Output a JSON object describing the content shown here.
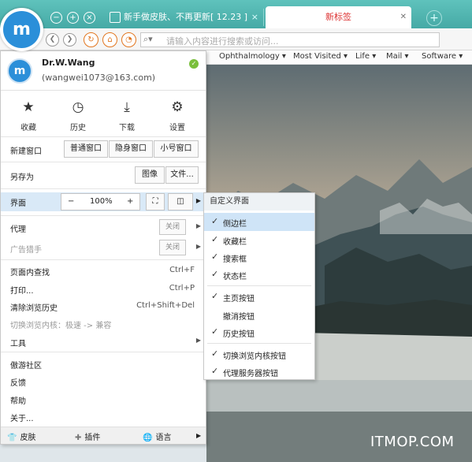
{
  "tabs": [
    {
      "label": "新手做皮肤、不再更新[ 12.23 ]",
      "active": false
    },
    {
      "label": "新标签",
      "active": true
    }
  ],
  "address_bar": {
    "placeholder": "请输入内容进行搜索或访问..."
  },
  "bookmarks": [
    "Ophthalmology",
    "Most Visited",
    "Life",
    "Mail",
    "Software"
  ],
  "user": {
    "name": "Dr.W.Wang",
    "email": "(wangwei1073@163.com)"
  },
  "quick_actions": [
    {
      "label": "收藏",
      "icon": "star-icon"
    },
    {
      "label": "历史",
      "icon": "clock-icon"
    },
    {
      "label": "下载",
      "icon": "download-icon"
    },
    {
      "label": "设置",
      "icon": "gear-icon"
    }
  ],
  "new_window": {
    "label": "新建窗口",
    "buttons": [
      "普通窗口",
      "隐身窗口",
      "小号窗口"
    ]
  },
  "save_as": {
    "label": "另存为",
    "buttons": [
      "图像",
      "文件..."
    ]
  },
  "zoom": {
    "label": "界面",
    "minus": "−",
    "value": "100%",
    "plus": "+"
  },
  "proxy": {
    "label": "代理",
    "state": "关闭"
  },
  "adblock": {
    "label": "广告猎手",
    "state": "关闭"
  },
  "menu_items": [
    {
      "label": "页面内查找",
      "shortcut": "Ctrl+F"
    },
    {
      "label": "打印...",
      "shortcut": "Ctrl+P"
    },
    {
      "label": "清除浏览历史",
      "shortcut": "Ctrl+Shift+Del"
    },
    {
      "label": "切换浏览内核：极速 -> 兼容",
      "shortcut": ""
    },
    {
      "label": "工具",
      "shortcut": ""
    }
  ],
  "menu_items_2": [
    "傲游社区",
    "反馈",
    "帮助",
    "关于..."
  ],
  "bottom_bar": [
    "皮肤",
    "插件",
    "语言"
  ],
  "submenu": {
    "header": "自定义界面",
    "items": [
      {
        "label": "侧边栏",
        "checked": true
      },
      {
        "label": "收藏栏",
        "checked": true
      },
      {
        "label": "搜索框",
        "checked": true
      },
      {
        "label": "状态栏",
        "checked": true
      },
      {
        "label": "主页按钮",
        "checked": true
      },
      {
        "label": "撤消按钮",
        "checked": false
      },
      {
        "label": "历史按钮",
        "checked": true
      },
      {
        "label": "切换浏览内核按钮",
        "checked": true
      },
      {
        "label": "代理服务器按钮",
        "checked": true
      }
    ]
  },
  "watermark": "ITMOP.COM",
  "colors": {
    "title_bar": "#4db3ae",
    "accent": "#2b8fd9",
    "orange": "#e2761f",
    "highlight": "#cfe4f7"
  }
}
